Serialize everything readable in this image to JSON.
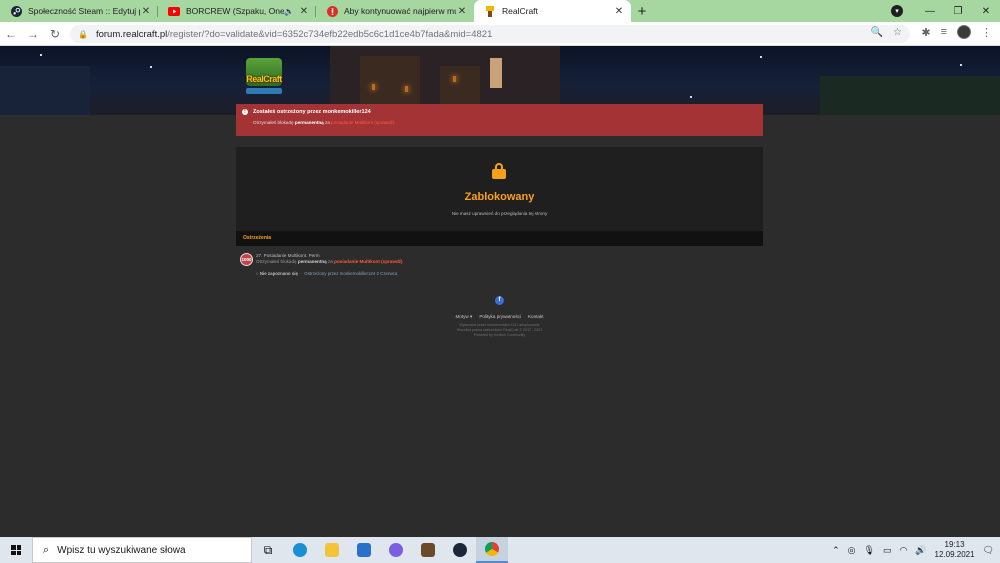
{
  "browser": {
    "tabs": [
      {
        "title": "Społeczność Steam :: Edytuj profil",
        "icon": "steam-icon",
        "active": false
      },
      {
        "title": "BORCREW (Szpaku, Onek87 ...",
        "icon": "youtube-icon",
        "active": false,
        "audio": true
      },
      {
        "title": "Aby kontynuować najpierw musi...",
        "icon": "notification-icon",
        "active": false
      },
      {
        "title": "RealCraft",
        "icon": "realcraft-icon",
        "active": true
      }
    ],
    "url_host": "forum.realcraft.pl",
    "url_path": "/register/?do=validate&vid=6352c734efb22edb5c6c1d1ce4b7fada&mid=4821"
  },
  "page": {
    "logo_text": "RealCraft",
    "alert": {
      "title": "Zostałeś ostrzeżony przez monkemokiller124",
      "body_prefix": "Otrzymałeś blokadę",
      "body_bold": "permanentną",
      "body_middle": "za",
      "body_link": "posiadanie Multikont (sprawdź)"
    },
    "locked": {
      "title": "Zablokowany",
      "message": "Nie masz uprawnień do przeglądania tej strony"
    },
    "warnings_header": "Ostrzeżenia",
    "warning": {
      "points": "1000",
      "title": "27. Posiadanie Multikont. Perm",
      "line_prefix": "Otrzymałeś blokadę",
      "line_bold": "permanentną",
      "line_middle": "za",
      "line_link": "posiadanie Multikont (sprawdź)",
      "ack_label": "Nie zapoznano się",
      "meta": "Ostrzeżony przez monkemokiller124 2 Czerwca"
    },
    "footer": {
      "links": [
        "Motyw ▾",
        "Polityka prywatności",
        "Kontakt"
      ],
      "line1": "Wykonane przez monkemokiller124 i adoptowanie",
      "line2": "Wszelkie prawa zastrzeżone RealCraft © 2017 - 2021",
      "line3": "Powered by Invision Community"
    }
  },
  "taskbar": {
    "search_placeholder": "Wpisz tu wyszukiwane słowa",
    "time": "19:13",
    "date": "12.09.2021"
  },
  "colors": {
    "tab_strip": "#a7d7a0",
    "alert_bg": "#a33335",
    "accent_orange": "#f7a11a",
    "page_bg": "#2c2c2c",
    "panel_bg": "#1f1f1f"
  }
}
